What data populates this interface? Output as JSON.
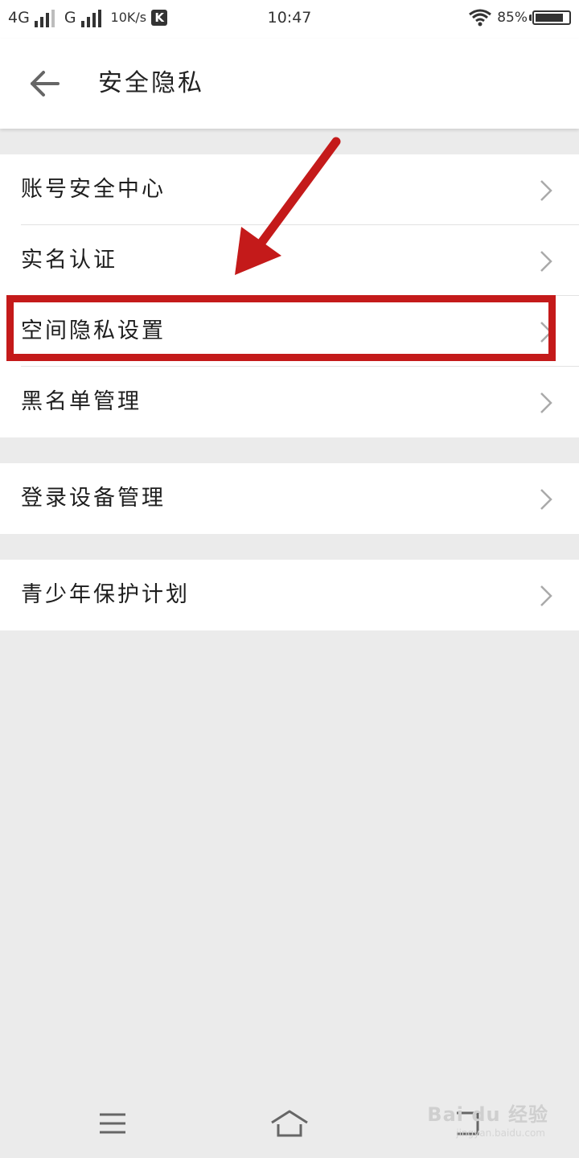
{
  "status_bar": {
    "network_1": "4G",
    "network_2": "G",
    "speed": "10K/s",
    "app_badge": "K",
    "time": "10:47",
    "battery": "85%",
    "battery_level": 0.85
  },
  "header": {
    "title": "安全隐私",
    "back_icon": "arrow-left-icon"
  },
  "groups": [
    {
      "items": [
        {
          "label": "账号安全中心"
        },
        {
          "label": "实名认证"
        },
        {
          "label": "空间隐私设置"
        },
        {
          "label": "黑名单管理"
        }
      ]
    },
    {
      "items": [
        {
          "label": "登录设备管理"
        }
      ]
    },
    {
      "items": [
        {
          "label": "青少年保护计划"
        }
      ]
    }
  ],
  "annotation": {
    "highlighted_item": "空间隐私设置",
    "color": "#c41a1a"
  },
  "nav_bar": {
    "buttons": [
      "menu-icon",
      "home-icon",
      "back-icon"
    ]
  },
  "watermark": {
    "text": "Bai du 经验",
    "sub": "jingyan.baidu.com"
  },
  "colors": {
    "background": "#ebebeb",
    "surface": "#ffffff",
    "accent_annotation": "#c41a1a"
  }
}
